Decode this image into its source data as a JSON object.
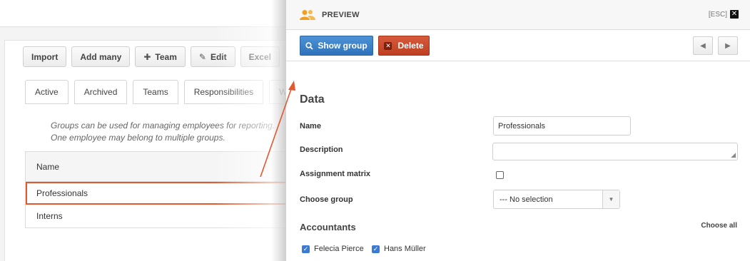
{
  "toolbar": {
    "import": "Import",
    "add_many": "Add many",
    "team": "Team",
    "edit": "Edit",
    "excel": "Excel"
  },
  "tabs": [
    "Active",
    "Archived",
    "Teams",
    "Responsibilities",
    "Wo"
  ],
  "info": {
    "line1": "Groups can be used for managing employees for reporting.",
    "line2": "One employee may belong to multiple groups."
  },
  "table": {
    "header": "Name",
    "rows": [
      "Professionals",
      "Interns"
    ]
  },
  "preview": {
    "title": "PREVIEW",
    "esc": "[ESC]",
    "show_group": "Show group",
    "delete": "Delete",
    "section_data": "Data",
    "name_label": "Name",
    "name_value": "Professionals",
    "description_label": "Description",
    "description_value": "",
    "assignment_label": "Assignment matrix",
    "choose_group_label": "Choose group",
    "choose_group_value": "--- No selection",
    "accountants_title": "Accountants",
    "choose_all": "Choose all",
    "employees": [
      "Felecia Pierce",
      "Hans Müller"
    ]
  },
  "colors": {
    "highlight": "#e3582e",
    "primary": "#2f72bb",
    "danger": "#be3f22",
    "group_icon": "#f0a020"
  }
}
